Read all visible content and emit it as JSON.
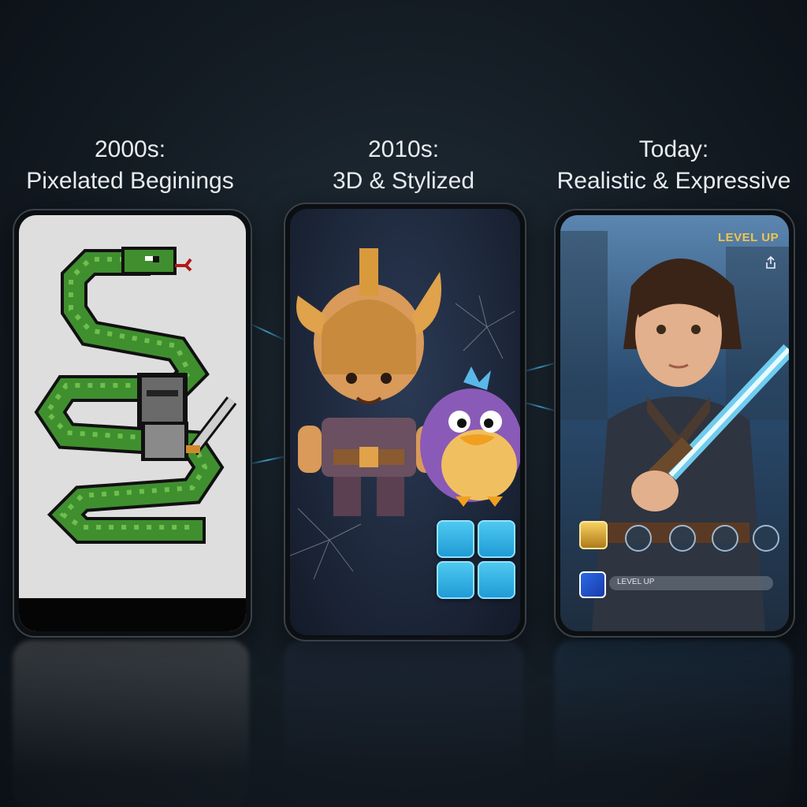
{
  "eras": [
    {
      "line1": "2000s:",
      "line2": "Pixelated Beginings"
    },
    {
      "line1": "2010s:",
      "line2": "3D & Stylized"
    },
    {
      "line1": "Today:",
      "line2": "Realistic & Expressive"
    }
  ],
  "modern_ui": {
    "badge": "LEVEL UP",
    "bar_label": "LEVEL UP"
  },
  "colors": {
    "pixel_green": "#3f8f2f",
    "accent_blue": "#4fc8f0",
    "gold": "#f1c64a"
  }
}
